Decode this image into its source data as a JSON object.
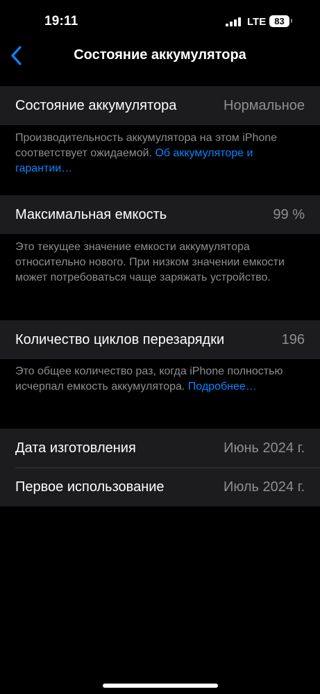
{
  "status_bar": {
    "time": "19:11",
    "network": "LTE",
    "battery_level": "83"
  },
  "nav": {
    "title": "Состояние аккумулятора"
  },
  "battery_health": {
    "label": "Состояние аккумулятора",
    "value": "Нормальное",
    "footnote_text": "Производительность аккумулятора на этом iPhone соответствует ожидаемой. ",
    "footnote_link": "Об аккумуля­торе и гарантии…"
  },
  "max_capacity": {
    "label": "Максимальная емкость",
    "value": "99 %",
    "footnote_text": "Это текущее значение емкости аккумулятора относительно нового. При низком значении емкости может потребоваться чаще заряжать устройство."
  },
  "cycle_count": {
    "label": "Количество циклов перезарядки",
    "value": "196",
    "footnote_text": "Это общее количество раз, когда iPhone полностью исчерпал емкость аккумулятора. ",
    "footnote_link": "Подробнее…"
  },
  "dates": {
    "manufacture_label": "Дата изготовления",
    "manufacture_value": "Июнь 2024 г.",
    "first_use_label": "Первое использование",
    "first_use_value": "Июль 2024 г."
  },
  "colors": {
    "background": "#000000",
    "cell": "#1c1c1e",
    "secondary_text": "#8e8e93",
    "link": "#0a84ff"
  }
}
